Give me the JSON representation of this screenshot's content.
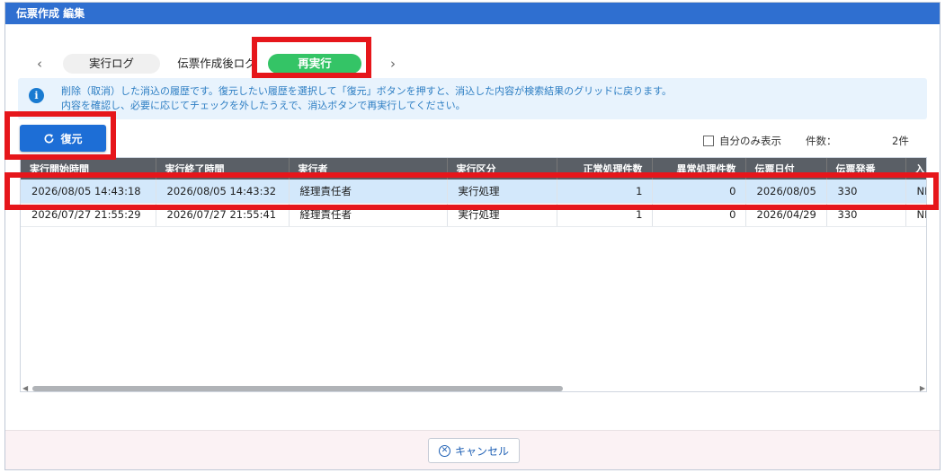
{
  "window": {
    "title": "伝票作成 編集"
  },
  "tabs": [
    {
      "label": "実行ログ"
    },
    {
      "label": "伝票作成後ログ"
    },
    {
      "label": "再実行"
    }
  ],
  "info": {
    "line1": "削除（取消）した消込の履歴です。復元したい履歴を選択して「復元」ボタンを押すと、消込した内容が検索結果のグリッドに戻ります。",
    "line2": "内容を確認し、必要に応じてチェックを外したうえで、消込ボタンで再実行してください。"
  },
  "toolbar": {
    "restore_label": "復元",
    "self_only_label": "自分のみ表示",
    "count_label": "件数：",
    "count_value": "2件"
  },
  "grid": {
    "columns": [
      "実行開始時間",
      "実行終了時間",
      "実行者",
      "実行区分",
      "正常処理件数",
      "異常処理件数",
      "伝票日付",
      "伝票発番",
      "入"
    ],
    "rows": [
      [
        "2026/08/05 14:43:18",
        "2026/08/05 14:43:32",
        "経理責任者",
        "実行処理",
        "1",
        "0",
        "2026/08/05",
        "330",
        "NE"
      ],
      [
        "2026/07/27 21:55:29",
        "2026/07/27 21:55:41",
        "経理責任者",
        "実行処理",
        "1",
        "0",
        "2026/04/29",
        "330",
        "NE"
      ]
    ]
  },
  "footer": {
    "cancel_label": "キャンセル"
  },
  "colors": {
    "titlebar": "#2f6fd0",
    "active_tab": "#34c466",
    "primary_button": "#1d6ed6",
    "highlight": "#e6161b"
  }
}
